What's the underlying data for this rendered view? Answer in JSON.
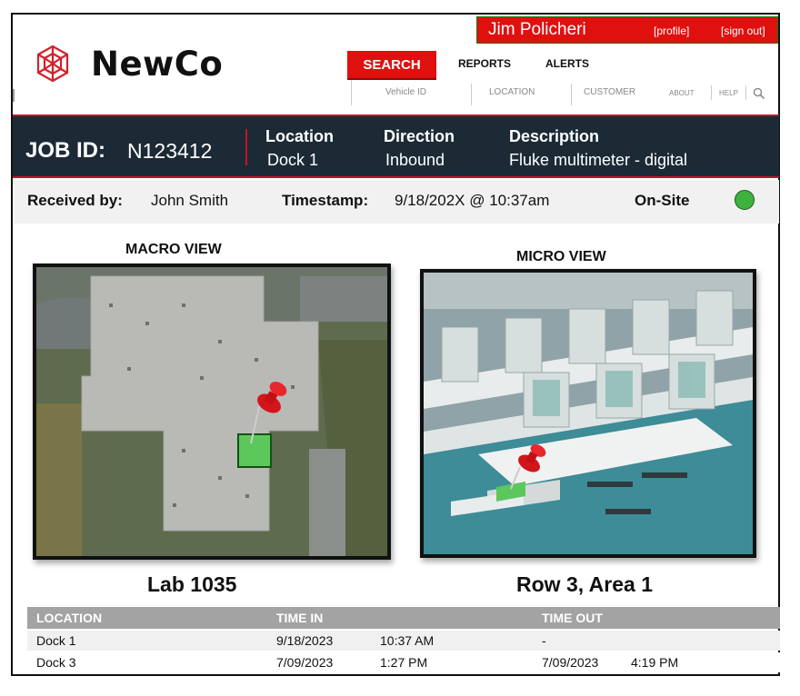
{
  "user": {
    "name": "Jim Policheri",
    "profile_link": "[profile]",
    "signout_link": "[sign out]"
  },
  "brand": {
    "name": "NewCo",
    "icon": "geodesic-globe-icon",
    "accent": "#e0100f"
  },
  "nav": {
    "search": "SEARCH",
    "reports": "REPORTS",
    "alerts": "ALERTS",
    "sub": [
      "Vehicle ID",
      "LOCATION",
      "CUSTOMER"
    ],
    "about": "ABOUT",
    "help": "HELP",
    "search_icon": "search-icon"
  },
  "job": {
    "id_label": "JOB ID:",
    "id_value": "N123412",
    "location_label": "Location",
    "location_value": "Dock 1",
    "direction_label": "Direction",
    "direction_value": "Inbound",
    "description_label": "Description",
    "description_value": "Fluke multimeter - digital"
  },
  "info": {
    "received_label": "Received by:",
    "received_value": "John Smith",
    "timestamp_label": "Timestamp:",
    "timestamp_value": "9/18/202X @ 10:37am",
    "status_label": "On-Site",
    "status_color": "#3db23d"
  },
  "views": {
    "macro_title": "MACRO VIEW",
    "macro_caption": "Lab 1035",
    "micro_title": "MICRO VIEW",
    "micro_caption": "Row 3, Area 1",
    "marker_icon": "red-pushpin-icon",
    "highlight_color": "#5cc85c"
  },
  "history": {
    "headers": [
      "LOCATION",
      "TIME IN",
      "TIME OUT"
    ],
    "rows": [
      {
        "location": "Dock 1",
        "in_date": "9/18/2023",
        "in_time": "10:37 AM",
        "out_date": "-",
        "out_time": ""
      },
      {
        "location": "Dock 3",
        "in_date": "7/09/2023",
        "in_time": "1:27 PM",
        "out_date": "7/09/2023",
        "out_time": "4:19 PM"
      }
    ]
  }
}
